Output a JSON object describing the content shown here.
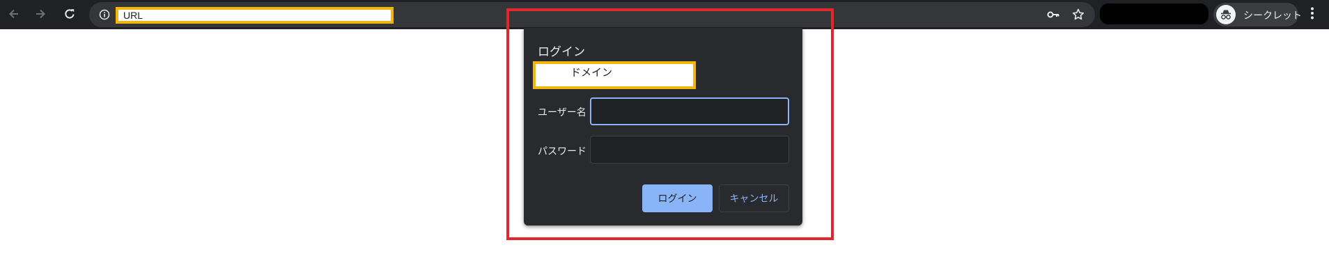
{
  "browser": {
    "url": "URL",
    "profile_label": "シークレット"
  },
  "icons": {
    "back": "arrow-left-icon",
    "forward": "arrow-right-icon",
    "reload": "reload-icon",
    "site_info": "info-icon",
    "password_key": "key-icon",
    "bookmark": "star-icon",
    "incognito": "incognito-icon",
    "menu": "more-vert-icon"
  },
  "dialog": {
    "title": "ログイン",
    "domain": "ドメイン",
    "username_label": "ユーザー名",
    "username_value": "",
    "password_label": "パスワード",
    "password_value": "",
    "login_button": "ログイン",
    "cancel_button": "キャンセル"
  },
  "colors": {
    "toolbar_bg": "#202124",
    "dialog_bg": "#292a2d",
    "accent": "#8ab4f8",
    "highlight_border": "#f2b60e",
    "annotation_border": "#e3262c"
  }
}
